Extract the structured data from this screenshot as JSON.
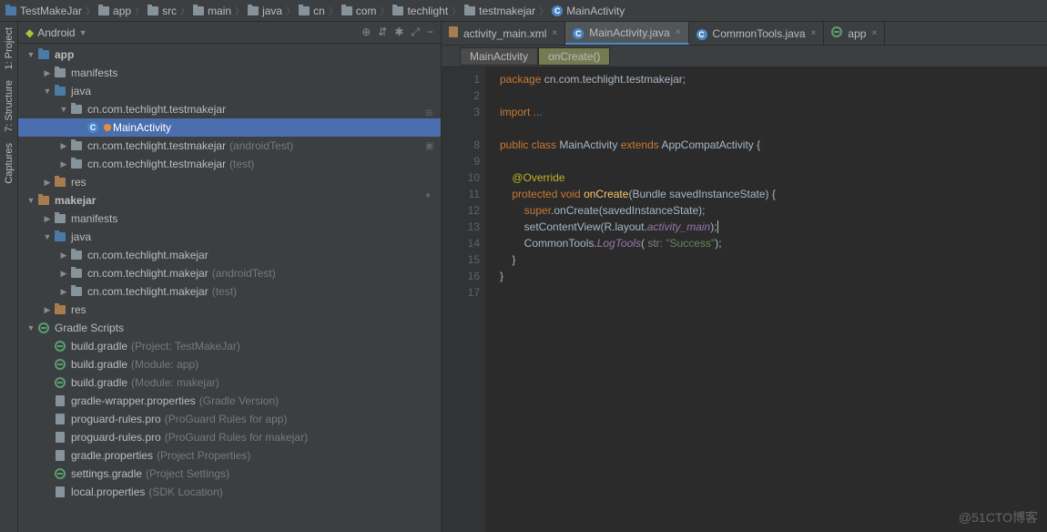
{
  "breadcrumbs": [
    "TestMakeJar",
    "app",
    "src",
    "main",
    "java",
    "cn",
    "com",
    "techlight",
    "testmakejar",
    "MainActivity"
  ],
  "side_tabs": {
    "project": "1: Project",
    "structure": "7: Structure",
    "captures": "Captures"
  },
  "panel": {
    "title": "Android",
    "toolbar_icons": [
      "target-icon",
      "collapse-icon",
      "settings-icon",
      "hide-icon",
      "minimize-icon"
    ]
  },
  "tree": [
    {
      "d": 0,
      "a": "▼",
      "i": "folder-blue",
      "l": "app",
      "bold": true
    },
    {
      "d": 1,
      "a": "▶",
      "i": "folder",
      "l": "manifests"
    },
    {
      "d": 1,
      "a": "▼",
      "i": "folder-blue",
      "l": "java"
    },
    {
      "d": 2,
      "a": "▼",
      "i": "folder",
      "l": "cn.com.techlight.testmakejar"
    },
    {
      "d": 3,
      "a": "",
      "i": "class",
      "l": "MainActivity",
      "sel": true,
      "pin": true
    },
    {
      "d": 2,
      "a": "▶",
      "i": "folder",
      "l": "cn.com.techlight.testmakejar",
      "dim": "(androidTest)"
    },
    {
      "d": 2,
      "a": "▶",
      "i": "folder",
      "l": "cn.com.techlight.testmakejar",
      "dim": "(test)"
    },
    {
      "d": 1,
      "a": "▶",
      "i": "folder-orange",
      "l": "res"
    },
    {
      "d": 0,
      "a": "▼",
      "i": "folder-orange",
      "l": "makejar",
      "bold": true
    },
    {
      "d": 1,
      "a": "▶",
      "i": "folder",
      "l": "manifests"
    },
    {
      "d": 1,
      "a": "▼",
      "i": "folder-blue",
      "l": "java"
    },
    {
      "d": 2,
      "a": "▶",
      "i": "folder",
      "l": "cn.com.techlight.makejar"
    },
    {
      "d": 2,
      "a": "▶",
      "i": "folder",
      "l": "cn.com.techlight.makejar",
      "dim": "(androidTest)"
    },
    {
      "d": 2,
      "a": "▶",
      "i": "folder",
      "l": "cn.com.techlight.makejar",
      "dim": "(test)"
    },
    {
      "d": 1,
      "a": "▶",
      "i": "folder-orange",
      "l": "res"
    },
    {
      "d": 0,
      "a": "▼",
      "i": "gradle",
      "l": "Gradle Scripts"
    },
    {
      "d": 1,
      "a": "",
      "i": "gradle",
      "l": "build.gradle",
      "dim": "(Project: TestMakeJar)"
    },
    {
      "d": 1,
      "a": "",
      "i": "gradle",
      "l": "build.gradle",
      "dim": "(Module: app)"
    },
    {
      "d": 1,
      "a": "",
      "i": "gradle",
      "l": "build.gradle",
      "dim": "(Module: makejar)"
    },
    {
      "d": 1,
      "a": "",
      "i": "file",
      "l": "gradle-wrapper.properties",
      "dim": "(Gradle Version)"
    },
    {
      "d": 1,
      "a": "",
      "i": "file",
      "l": "proguard-rules.pro",
      "dim": "(ProGuard Rules for app)"
    },
    {
      "d": 1,
      "a": "",
      "i": "file",
      "l": "proguard-rules.pro",
      "dim": "(ProGuard Rules for makejar)"
    },
    {
      "d": 1,
      "a": "",
      "i": "file",
      "l": "gradle.properties",
      "dim": "(Project Properties)"
    },
    {
      "d": 1,
      "a": "",
      "i": "gradle",
      "l": "settings.gradle",
      "dim": "(Project Settings)"
    },
    {
      "d": 1,
      "a": "",
      "i": "file",
      "l": "local.properties",
      "dim": "(SDK Location)"
    }
  ],
  "editor_tabs": [
    {
      "icon": "xml",
      "label": "activity_main.xml",
      "close": "×"
    },
    {
      "icon": "class",
      "label": "MainActivity.java",
      "close": "×",
      "active": true
    },
    {
      "icon": "class",
      "label": "CommonTools.java",
      "close": "×"
    },
    {
      "icon": "gradle",
      "label": "app",
      "close": "×"
    }
  ],
  "editor_bc": [
    "MainActivity",
    "onCreate()"
  ],
  "code": {
    "lines": [
      {
        "n": 1,
        "html": "<span class='kw'>package</span> <span class='ident'>cn.com.techlight.testmakejar;</span>"
      },
      {
        "n": 2,
        "html": ""
      },
      {
        "n": 3,
        "html": "<span class='kw'>import</span> <span class='com'>...</span>",
        "fold": "⊞"
      },
      {
        "n": "",
        "html": ""
      },
      {
        "n": 8,
        "html": "<span class='kw'>public class</span> <span class='ident'>MainActivity </span><span class='kw'>extends</span> <span class='ident'>AppCompatActivity {</span>",
        "gi": "▣"
      },
      {
        "n": 9,
        "html": ""
      },
      {
        "n": 10,
        "html": "    <span class='ann'>@Override</span>"
      },
      {
        "n": 11,
        "html": "    <span class='kw'>protected void</span> <span class='func'>onCreate</span><span class='ident'>(Bundle savedInstanceState) {</span>",
        "gi": "●"
      },
      {
        "n": 12,
        "html": "        <span class='kw'>super</span><span class='ident'>.onCreate(savedInstanceState);</span>"
      },
      {
        "n": 13,
        "html": "        <span class='ident'>setContentView(R.layout.</span><span class='it'>activity_main</span><span class='ident'>);</span><span class='cursor-caret'></span>"
      },
      {
        "n": 14,
        "html": "        <span class='ident'>CommonTools.</span><span class='it'>LogTools</span><span class='ident'>(</span> <span class='param'>str:</span> <span class='str'>\"Success\"</span><span class='ident'>);</span>"
      },
      {
        "n": 15,
        "html": "    <span class='ident'>}</span>"
      },
      {
        "n": 16,
        "html": "<span class='ident'>}</span>"
      },
      {
        "n": 17,
        "html": ""
      }
    ]
  },
  "watermark": "@51CTO博客"
}
